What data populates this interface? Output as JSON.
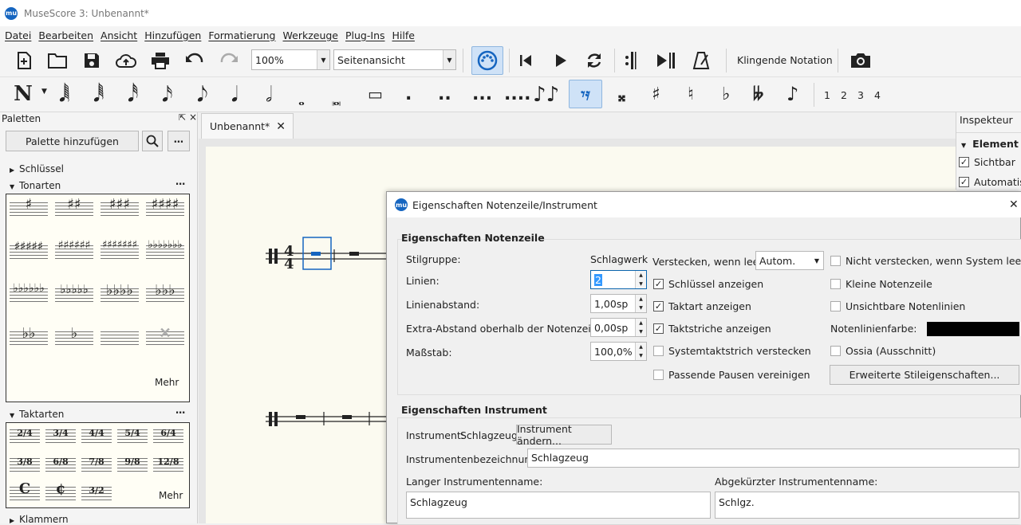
{
  "window": {
    "title": "MuseScore 3: Unbenannt*",
    "logo": "mu"
  },
  "menu": [
    "Datei",
    "Bearbeiten",
    "Ansicht",
    "Hinzufügen",
    "Formatierung",
    "Werkzeuge",
    "Plug-Ins",
    "Hilfe"
  ],
  "toolbar": {
    "zoom": "100%",
    "view_mode": "Seitenansicht",
    "concert_pitch": "Klingende Notation"
  },
  "note_input": {
    "mode_icon": "N",
    "voices": [
      "1",
      "2",
      "3",
      "4"
    ]
  },
  "palettes": {
    "title": "Paletten",
    "add_button": "Palette hinzufügen",
    "sections": [
      {
        "name": "Schlüssel",
        "expanded": false
      },
      {
        "name": "Tonarten",
        "expanded": true,
        "more": "Mehr"
      },
      {
        "name": "Taktarten",
        "expanded": true,
        "more": "Mehr"
      },
      {
        "name": "Klammern",
        "expanded": false
      }
    ],
    "time_signatures": [
      "2/4",
      "3/4",
      "4/4",
      "5/4",
      "6/4",
      "3/8",
      "6/8",
      "7/8",
      "9/8",
      "12/8",
      "C",
      "¢",
      "3/2"
    ]
  },
  "document_tab": {
    "label": "Unbenannt*"
  },
  "inspector": {
    "title": "Inspekteur",
    "section": "Element",
    "items": [
      {
        "label": "Sichtbar",
        "checked": true
      },
      {
        "label": "Automatis",
        "checked": true
      }
    ]
  },
  "dialog": {
    "title": "Eigenschaften Notenzeile/Instrument",
    "staff": {
      "title": "Eigenschaften Notenzeile",
      "style_group_label": "Stilgruppe:",
      "style_group_value": "Schlagwerk",
      "lines_label": "Linien:",
      "lines_value": "2",
      "spacing_label": "Linienabstand:",
      "spacing_value": "1,00sp",
      "extra_label": "Extra-Abstand oberhalb der Notenzeile:",
      "extra_value": "0,00sp",
      "scale_label": "Maßstab:",
      "scale_value": "100,0%",
      "hide_label": "Verstecken, wenn leer:",
      "hide_value": "Autom.",
      "checks_mid": [
        {
          "label": "Schlüssel anzeigen",
          "checked": true
        },
        {
          "label": "Taktart anzeigen",
          "checked": true
        },
        {
          "label": "Taktstriche anzeigen",
          "checked": true
        },
        {
          "label": "Systemtaktstrich verstecken",
          "checked": false
        },
        {
          "label": "Passende Pausen vereinigen",
          "checked": false
        }
      ],
      "checks_right": [
        {
          "label": "Nicht verstecken, wenn System leer ist",
          "checked": false
        },
        {
          "label": "Kleine Notenzeile",
          "checked": false
        },
        {
          "label": "Unsichtbare Notenlinien",
          "checked": false
        }
      ],
      "color_label": "Notenlinienfarbe:",
      "color_value": "#000000",
      "ossia": {
        "label": "Ossia (Ausschnitt)",
        "checked": false
      },
      "advanced_button": "Erweiterte Stileigenschaften..."
    },
    "instrument": {
      "title": "Eigenschaften Instrument",
      "instrument_label": "Instrument:",
      "instrument_value": "Schlagzeug",
      "change_button": "Instrument ändern...",
      "designation_label": "Instrumentenbezeichnung:",
      "designation_value": "Schlagzeug",
      "long_name_label": "Langer Instrumentenname:",
      "long_name_value": "Schlagzeug",
      "short_name_label": "Abgekürzter Instrumentenname:",
      "short_name_value": "Schlgz."
    }
  }
}
